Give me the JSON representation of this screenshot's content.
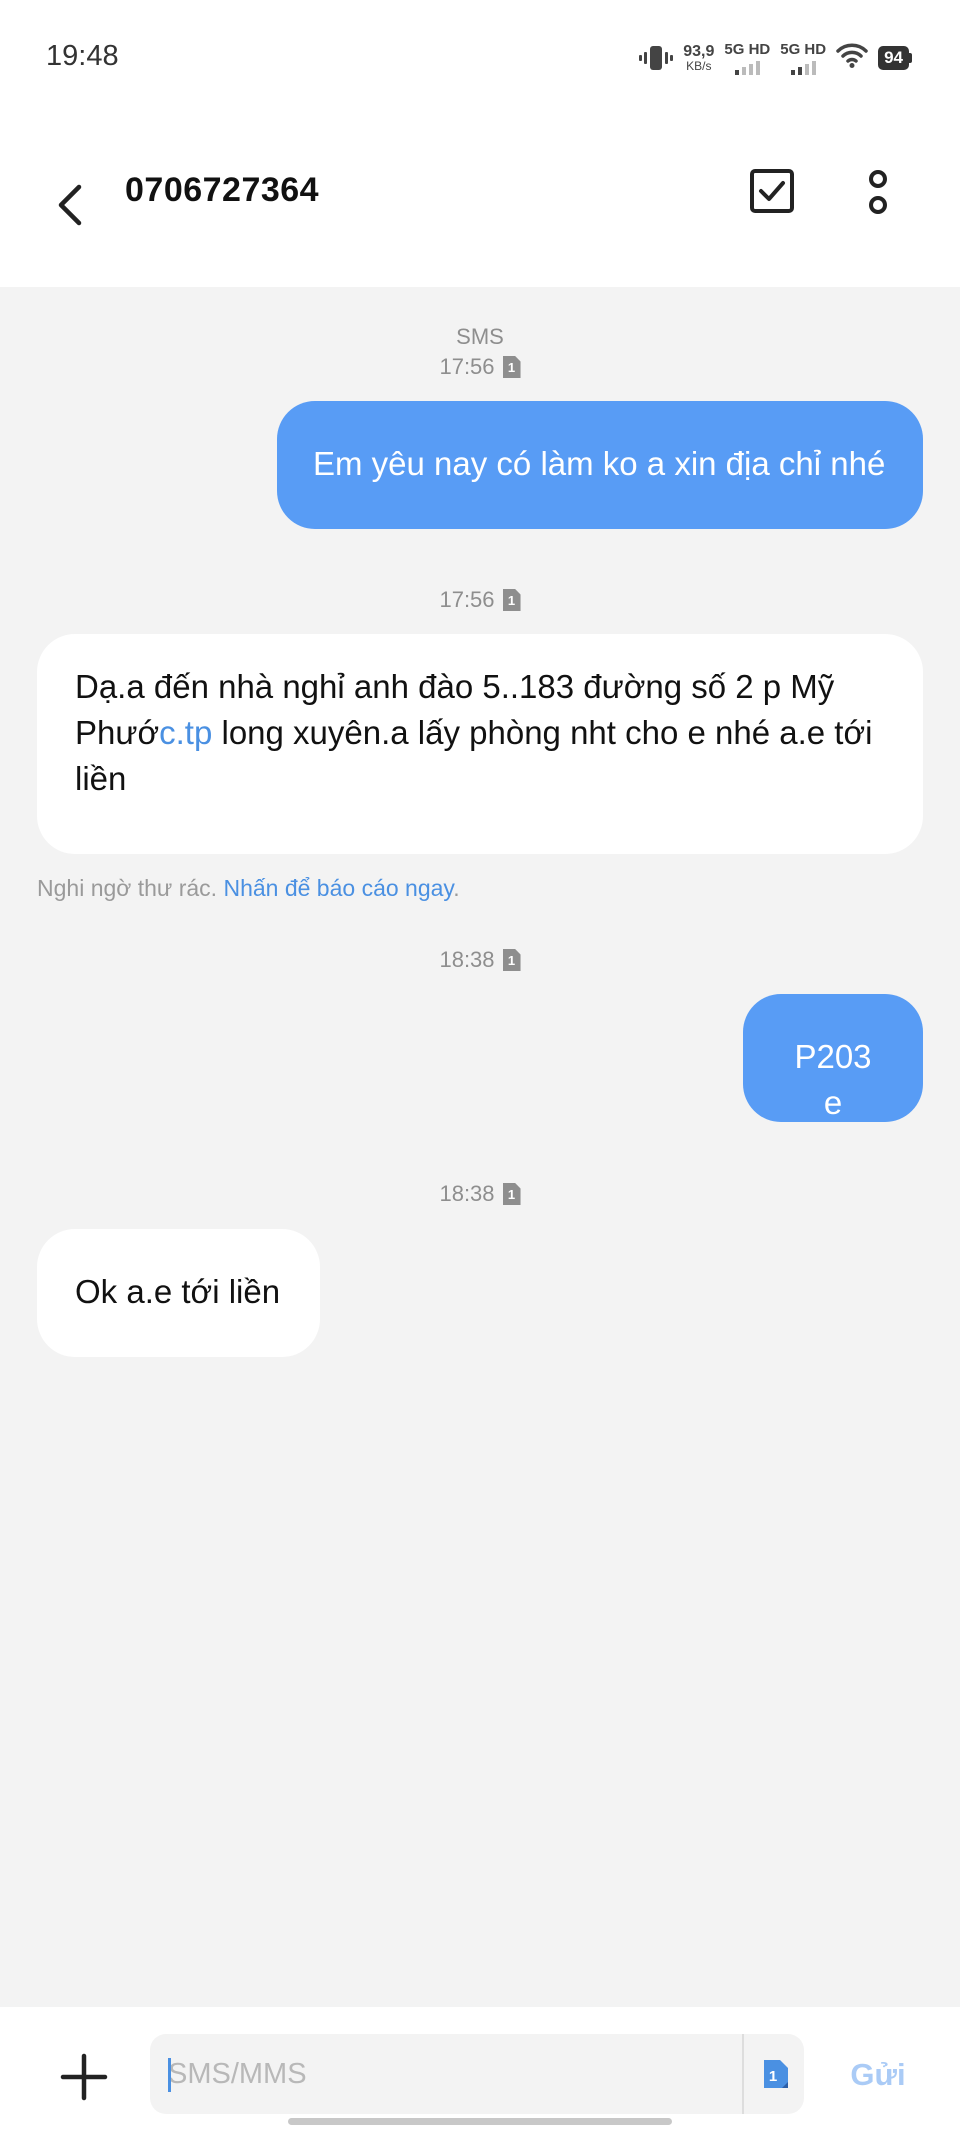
{
  "status_bar": {
    "time": "19:48",
    "net_speed_value": "93,9",
    "net_speed_unit": "KB/s",
    "sim1_label": "5G HD",
    "sim2_label": "5G HD",
    "battery": "94"
  },
  "header": {
    "contact": "0706727364"
  },
  "conversation": {
    "channel_label": "SMS",
    "messages": [
      {
        "direction": "outgoing",
        "time": "17:56",
        "sim": "1",
        "text": "Em yêu nay có làm ko a xin địa chỉ nhé"
      },
      {
        "direction": "incoming",
        "time": "17:56",
        "sim": "1",
        "text_before_link": "Dạ.a đến nhà nghỉ anh đào 5..183 đường số 2 p Mỹ Phướ",
        "link": "c.tp",
        "text_after_link": " long xuyên.a lấy phòng nht cho e nhé a.e tới liền"
      },
      {
        "direction": "outgoing",
        "time": "18:38",
        "sim": "1",
        "text": "P203 e"
      },
      {
        "direction": "incoming",
        "time": "18:38",
        "sim": "1",
        "text": "Ok a.e tới liền"
      }
    ],
    "spam_notice": "Nghi ngờ thư rác. ",
    "spam_report_link": "Nhấn để báo cáo ngay",
    "spam_notice_end": "."
  },
  "composer": {
    "placeholder": "SMS/MMS",
    "sim": "1",
    "send_label": "Gửi"
  },
  "colors": {
    "outgoing_bubble": "#589cf5",
    "incoming_bubble": "#ffffff",
    "link": "#4a90e2",
    "background": "#f3f3f3"
  }
}
